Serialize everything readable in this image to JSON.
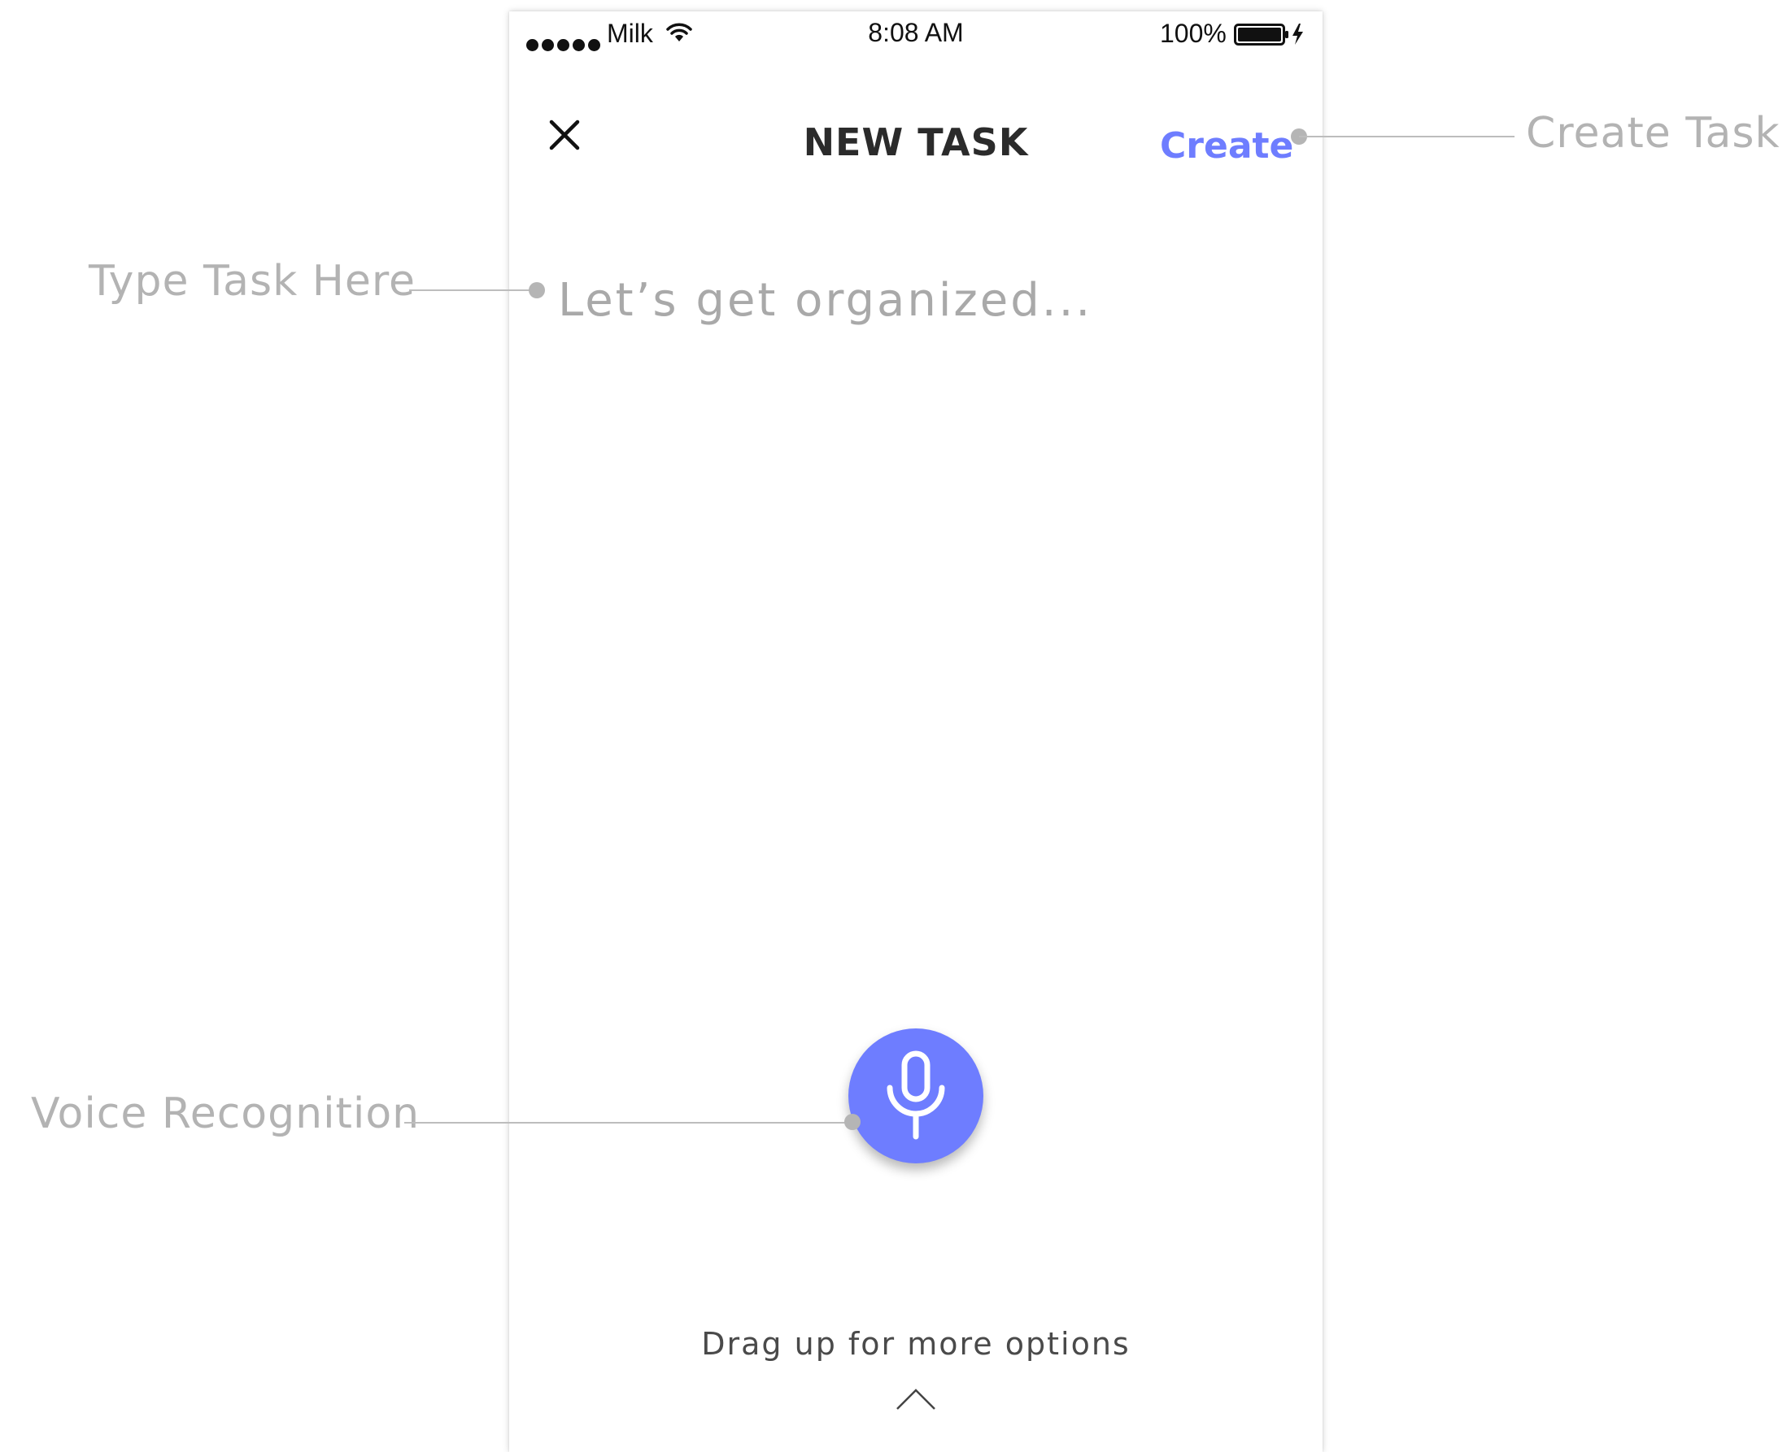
{
  "status_bar": {
    "carrier": "Milk",
    "time": "8:08 AM",
    "battery_percent": "100%",
    "signal_icon": "signal-dots-icon",
    "wifi_icon": "wifi-icon",
    "battery_icon": "battery-charging-icon"
  },
  "nav": {
    "close_icon": "close-icon",
    "title": "NEW TASK",
    "create_label": "Create"
  },
  "task_input": {
    "placeholder": "Let’s get organized..."
  },
  "voice": {
    "icon": "microphone-icon"
  },
  "drag_hint": {
    "label": "Drag up for more options",
    "icon": "chevron-up-icon"
  },
  "annotations": {
    "create_task": "Create Task",
    "type_task": "Type Task Here",
    "voice_recognition": "Voice Recognition"
  },
  "colors": {
    "accent": "#6e7dff",
    "annotation_text": "#b3b3b3",
    "title_text": "#2b2b2b"
  }
}
